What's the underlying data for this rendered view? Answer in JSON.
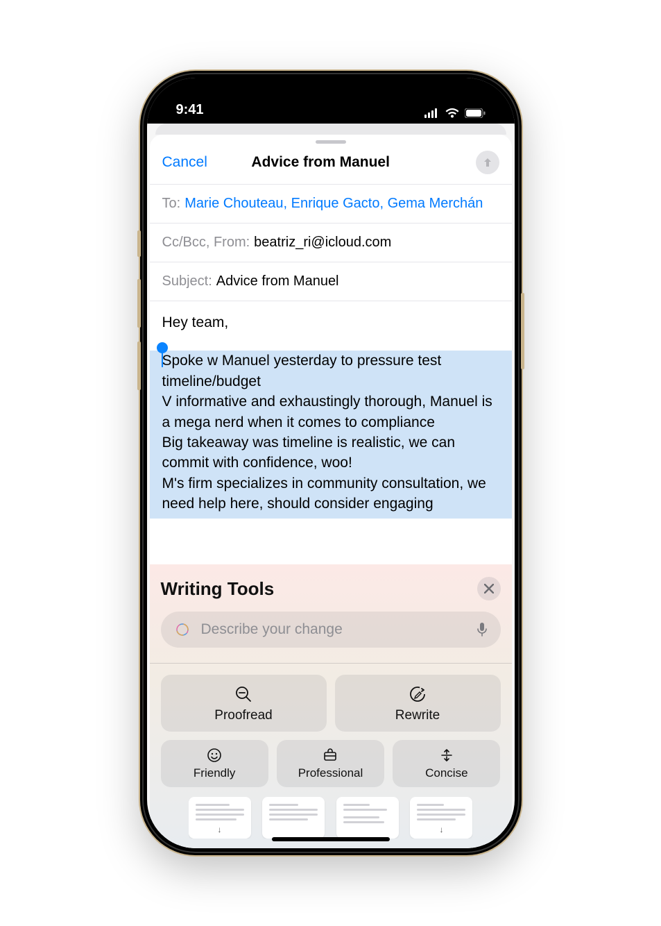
{
  "statusbar": {
    "time": "9:41"
  },
  "compose": {
    "cancel": "Cancel",
    "title": "Advice from Manuel",
    "to_label": "To:",
    "recipients": "Marie Chouteau, Enrique Gacto, Gema Merchán",
    "ccbcc_label": "Cc/Bcc, From:",
    "from_value": "beatriz_ri@icloud.com",
    "subject_label": "Subject:",
    "subject_value": "Advice from Manuel",
    "body_greeting": "Hey team,",
    "body_selected": "Spoke w Manuel yesterday to pressure test timeline/budget\nV informative and exhaustingly thorough, Manuel is a mega nerd when it comes to compliance\nBig takeaway was timeline is realistic, we can commit with confidence, woo!\nM's firm specializes in community consultation, we need help here, should consider engaging"
  },
  "writing_tools": {
    "title": "Writing Tools",
    "placeholder": "Describe your change",
    "proofread": "Proofread",
    "rewrite": "Rewrite",
    "friendly": "Friendly",
    "professional": "Professional",
    "concise": "Concise"
  }
}
